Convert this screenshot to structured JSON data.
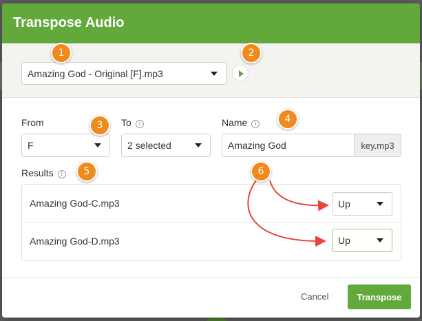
{
  "dialog": {
    "title": "Transpose Audio"
  },
  "audio": {
    "file": "Amazing God - Original [F].mp3",
    "play_icon": "play-icon"
  },
  "form": {
    "from_label": "From",
    "from_value": "F",
    "to_label": "To",
    "to_value": "2 selected",
    "name_label": "Name",
    "name_value": "Amazing God",
    "name_suffix": "key.mp3",
    "info_icon": "info-icon",
    "info_glyph": "i"
  },
  "results": {
    "label": "Results",
    "rows": [
      {
        "name": "Amazing God-C.mp3",
        "direction": "Up"
      },
      {
        "name": "Amazing God-D.mp3",
        "direction": "Up"
      }
    ]
  },
  "footer": {
    "cancel_label": "Cancel",
    "transpose_label": "Transpose"
  },
  "callouts": [
    "1",
    "2",
    "3",
    "4",
    "5",
    "6"
  ],
  "colors": {
    "header_green": "#62a83a",
    "callout_orange": "#f08a1c",
    "arrow_red": "#e8443a"
  }
}
